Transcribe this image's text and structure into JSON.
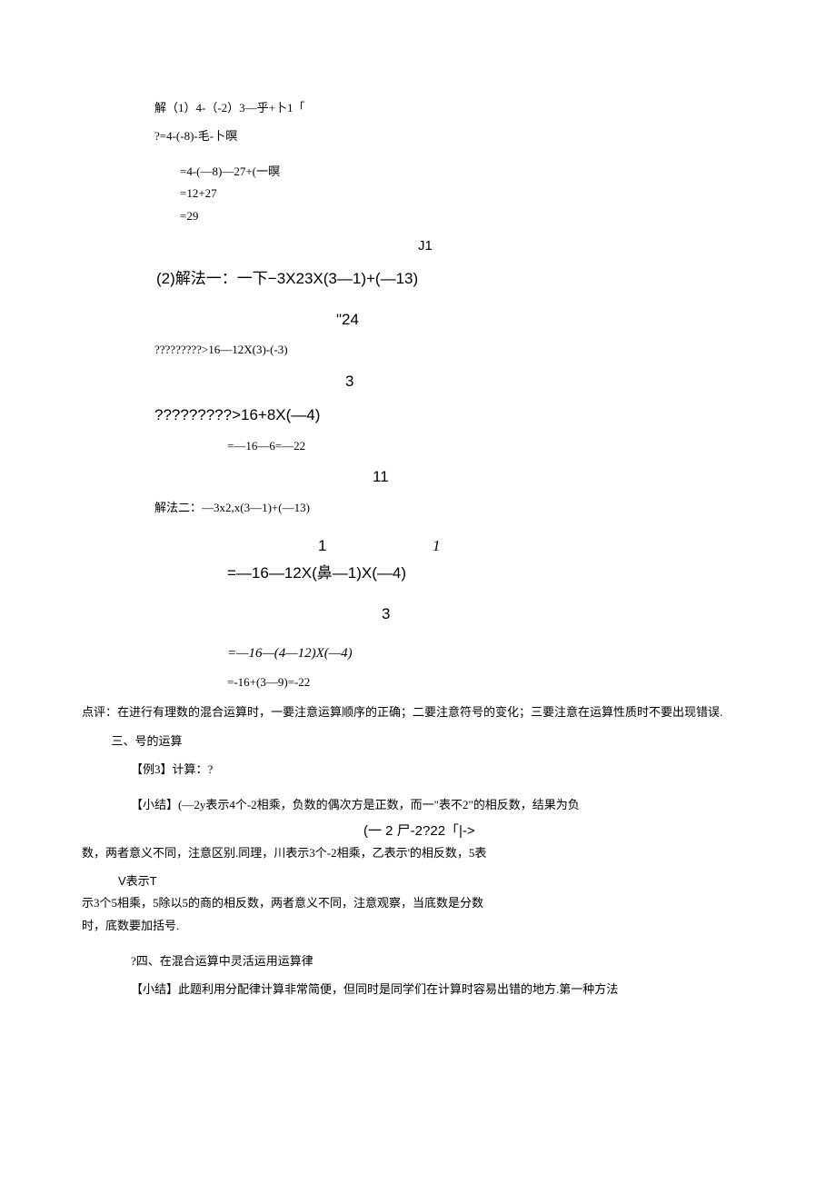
{
  "lines": {
    "l1": "解（1）4-（-2）3—乎+卜1「",
    "l2": "?=4-(-8)-毛-卜暝",
    "l3": "=4-(—8)—27+(一暝",
    "l4": "=12+27",
    "l5": "=29",
    "l6": "J1",
    "l7": "(2)解法一：一下−3X23X(3—1)+(—13)",
    "l8": "\"24",
    "l9": "?????????>16—12X(3)-(-3)",
    "l10": "3",
    "l11": "?????????>16+8X(—4)",
    "l12": "=—16—6=—22",
    "l13": "11",
    "l14": "解法二：—3x2,x(3—1)+(—13)",
    "l15a": "1",
    "l15b": "1",
    "l16": "=—16—12X(鼻—1)X(—4)",
    "l17": "3",
    "l18": "=—16—(4—12)X(—4)",
    "l19": "=-16+(3—9)=-22",
    "l20": "点评：在进行有理数的混合运算时，一要注意运算顺序的正确；二要注意符号的变化；三要注意在运算性质时不要出现错误.",
    "l21": "三、号的运算",
    "l22": "【例3】计算：?",
    "l23": "【小结】(—2y表示4个-2相乘，负数的偶次方是正数，而一\"表不2\"的相反数，结果为负",
    "l24": "(一 2 尸-2?22「|->",
    "l25": "数，两者意义不同，注意区别.同理，川表示3个-2相乘，乙表示'的相反数，5表",
    "l26": "V表示T",
    "l27": "示3个5相乘，5除以5的商的相反数，两者意义不同，注意观察，当底数是分数",
    "l28": "时，底数要加括号.",
    "l29": "?四、在混合运算中灵活运用运算律",
    "l30": "【小结】此题利用分配律计算非常简便，但同时是同学们在计算时容易出错的地方.第一种方法"
  }
}
